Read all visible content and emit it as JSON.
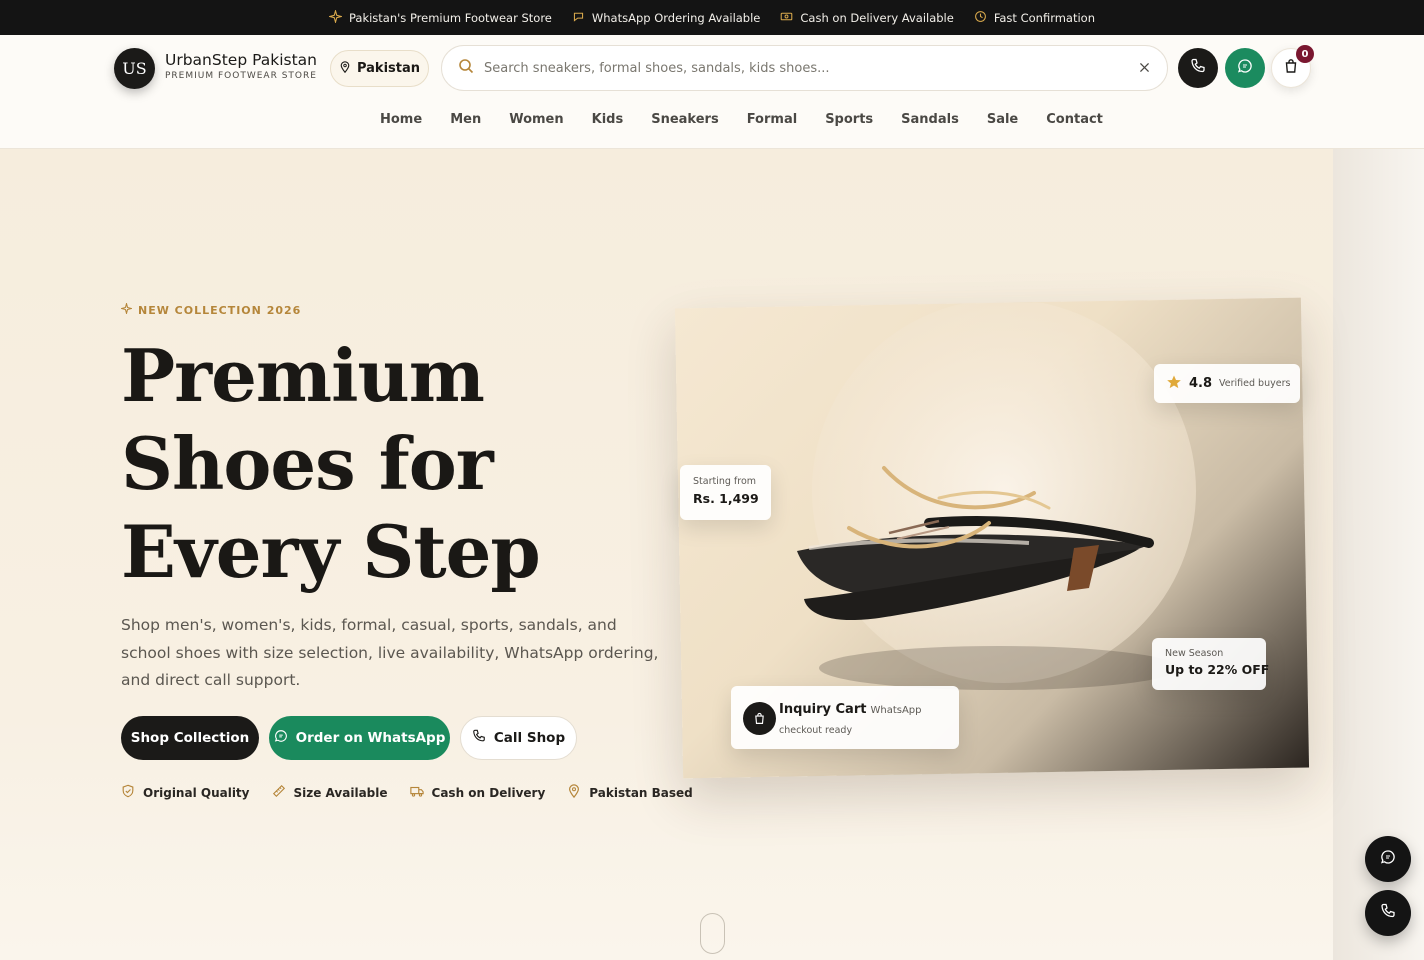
{
  "topbar": {
    "items": [
      {
        "icon": "sparkle-icon",
        "text": "Pakistan's Premium Footwear Store"
      },
      {
        "icon": "chat-icon",
        "text": "WhatsApp Ordering Available"
      },
      {
        "icon": "cash-icon",
        "text": "Cash on Delivery Available"
      },
      {
        "icon": "clock-icon",
        "text": "Fast Confirmation"
      }
    ]
  },
  "header": {
    "logo_initials": "US",
    "brand_name": "UrbanStep Pakistan",
    "brand_tagline": "PREMIUM FOOTWEAR STORE",
    "location": "Pakistan",
    "search_placeholder": "Search sneakers, formal shoes, sandals, kids shoes...",
    "search_value": "",
    "cart_count": "0",
    "nav": [
      "Home",
      "Men",
      "Women",
      "Kids",
      "Sneakers",
      "Formal",
      "Sports",
      "Sandals",
      "Sale",
      "Contact"
    ]
  },
  "hero": {
    "eyebrow": "NEW COLLECTION 2026",
    "headline": [
      "Premium",
      "Shoes for",
      "Every Step"
    ],
    "subtitle": "Shop men's, women's, kids, formal, casual, sports, sandals, and school shoes with size selection, live availability, WhatsApp ordering, and direct call support.",
    "buttons": {
      "shop": "Shop Collection",
      "whatsapp": "Order on WhatsApp",
      "call": "Call Shop"
    },
    "features": [
      {
        "icon": "shield-check-icon",
        "text": "Original Quality"
      },
      {
        "icon": "ruler-icon",
        "text": "Size Available"
      },
      {
        "icon": "truck-icon",
        "text": "Cash on Delivery"
      },
      {
        "icon": "map-pin-icon",
        "text": "Pakistan Based"
      }
    ]
  },
  "product_card": {
    "rating": {
      "value": "4.8",
      "label": "Verified buyers"
    },
    "price": {
      "label": "Starting from",
      "value": "Rs. 1,499"
    },
    "season": {
      "label": "New Season",
      "value": "Up to 22% OFF"
    },
    "inquiry": {
      "title": "Inquiry Cart",
      "channel": "WhatsApp",
      "status": "checkout ready"
    }
  },
  "colors": {
    "brand_dark": "#1b1a18",
    "whatsapp_green": "#1a8a5d",
    "accent_gold": "#b5863a",
    "badge_maroon": "#7a1730"
  }
}
